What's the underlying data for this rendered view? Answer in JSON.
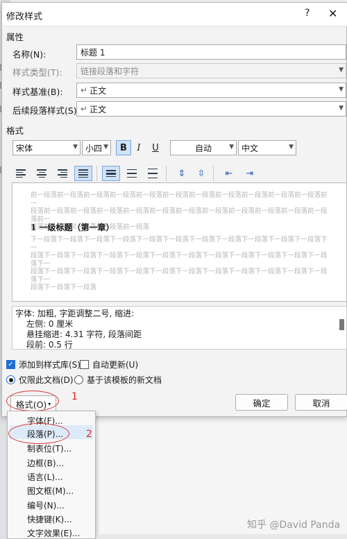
{
  "dialog": {
    "title": "修改样式",
    "help": "?",
    "close": "✕"
  },
  "properties": {
    "section": "属性",
    "name_label": "名称(N):",
    "name_value": "标题 1",
    "type_label": "样式类型(T):",
    "type_value": "链接段落和字符",
    "based_label": "样式基准(B):",
    "based_value": "正文",
    "next_label": "后续段落样式(S):",
    "next_value": "正文",
    "para_mark": "↵"
  },
  "format": {
    "section": "格式",
    "font": "宋体",
    "size": "小四",
    "bold": "B",
    "italic": "I",
    "underline": "U",
    "color": "自动",
    "lang": "中文"
  },
  "preview": {
    "prev_lines": [
      "前一段落前一段落前一段落前一段落前一段落前一段落前一段落前一段落前一段落前一段落前一段落前一",
      "段落前一段落前一段落前一段落前一段落前一段落前一段落前一段落前一段落前一段落前一段落前一段落前一",
      "段落前一段落前一段落前一段落前一段落"
    ],
    "heading": "1 一级标题（第一章）",
    "next_lines": [
      "下一段落下一段落下一段落下一段落下一段落下一段落下一段落下一段落下一段落下一段落下一段落下一",
      "段落下一段落下一段落下一段落下一段落下一段落下一段落下一段落下一段落下一段落下一段落下一段落下一",
      "段落下一段落下一段落下一段落下一段落下一段落下一段落下一段落下一段落下一段落下一段落下一段落下一",
      "段落下一段落下一段落"
    ]
  },
  "description": {
    "line1": "字体: 加粗, 字距调整二号, 缩进:",
    "line2": "左侧:  0 厘米",
    "line3": "悬挂缩进: 4.31 字符, 段落间距",
    "line4": "段前: 0.5 行"
  },
  "options": {
    "add_gallery": "添加到样式库(S)",
    "auto_update": "自动更新(U)",
    "only_doc": "仅限此文档(D)",
    "template": "基于该模板的新文档"
  },
  "buttons": {
    "format": "格式(O)",
    "ok": "确定",
    "cancel": "取消"
  },
  "annotations": {
    "step1": "1",
    "step2": "2"
  },
  "menu": {
    "items": [
      "字体(F)...",
      "段落(P)...",
      "制表位(T)...",
      "边框(B)...",
      "语言(L)...",
      "图文框(M)...",
      "编号(N)...",
      "快捷键(K)...",
      "文字效果(E)..."
    ]
  },
  "watermark": "知乎 @David Panda",
  "colors": {
    "accent": "#1f6fd1",
    "annotation_red": "#e02020"
  }
}
